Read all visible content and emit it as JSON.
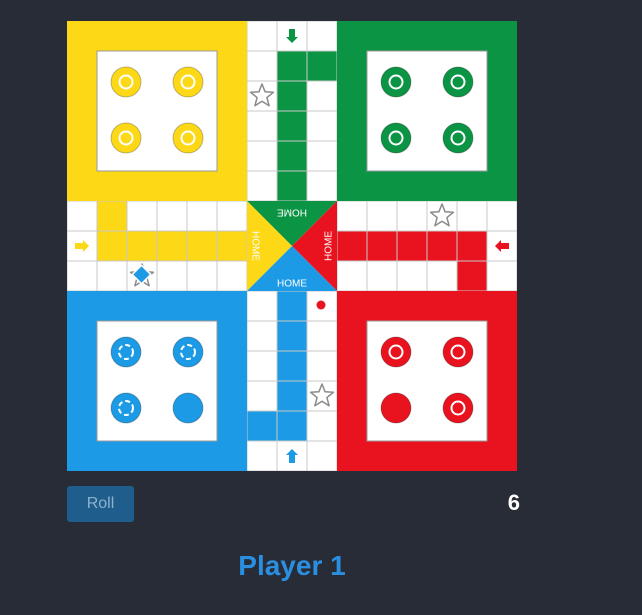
{
  "colors": {
    "yellow": "#fcd816",
    "green": "#0b9444",
    "red": "#e8131f",
    "blue": "#1c9ae5",
    "white": "#ffffff",
    "grid": "#c8c8c8",
    "star": "#8a8a8a",
    "page_bg": "#272c36",
    "button_bg": "#1f5d8c",
    "button_text": "#8fb2cc",
    "active_player": "#2a8fe0"
  },
  "board": {
    "home_label": "HOME",
    "yards": [
      {
        "color": "yellow",
        "tokens": [
          "ring",
          "ring",
          "ring",
          "ring"
        ]
      },
      {
        "color": "green",
        "tokens": [
          "ring",
          "ring",
          "ring",
          "ring"
        ]
      },
      {
        "color": "blue",
        "tokens": [
          "dashed-ring",
          "dashed-ring",
          "dashed-ring",
          "solid"
        ]
      },
      {
        "color": "red",
        "tokens": [
          "ring",
          "ring",
          "solid",
          "ring"
        ]
      }
    ],
    "entry_arrows": [
      {
        "color": "green",
        "icon": "arrow-down-icon"
      },
      {
        "color": "yellow",
        "icon": "arrow-right-icon"
      },
      {
        "color": "red",
        "icon": "arrow-left-icon"
      },
      {
        "color": "blue",
        "icon": "arrow-up-icon"
      }
    ],
    "safe_star_icon": "star-icon",
    "pieces_on_track": [
      {
        "color": "blue",
        "shape": "diamond",
        "on_star": true
      },
      {
        "color": "red",
        "shape": "dot"
      }
    ]
  },
  "controls": {
    "roll_label": "Roll",
    "dice_value": "6"
  },
  "status": {
    "current_player": "Player 1"
  }
}
